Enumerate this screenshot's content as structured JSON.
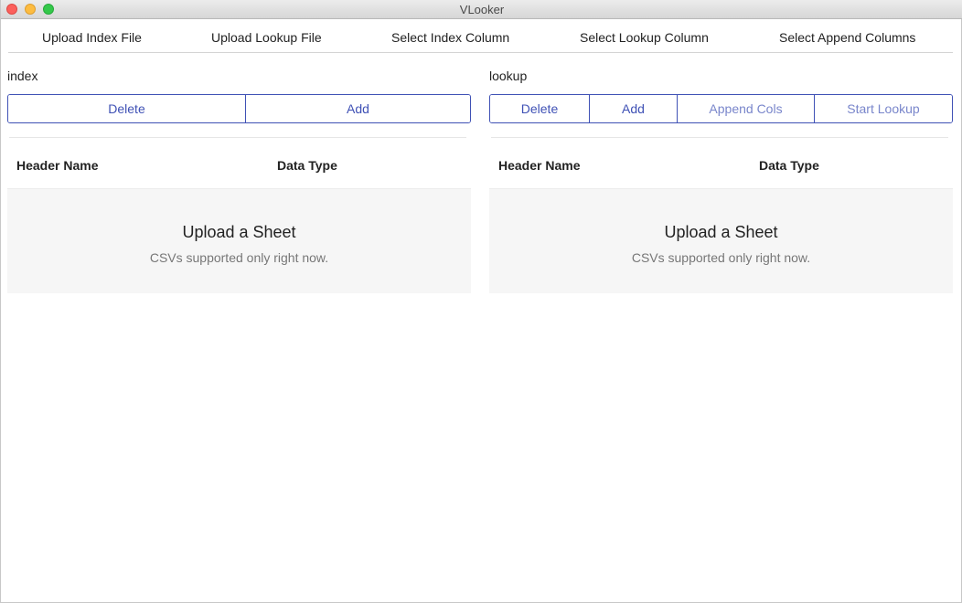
{
  "window": {
    "title": "VLooker"
  },
  "steps": [
    "Upload Index File",
    "Upload Lookup File",
    "Select Index Column",
    "Select Lookup Column",
    "Select Append Columns"
  ],
  "index_panel": {
    "label": "index",
    "buttons": {
      "delete": "Delete",
      "add": "Add"
    },
    "columns": {
      "header_name": "Header Name",
      "data_type": "Data Type"
    },
    "empty": {
      "title": "Upload a Sheet",
      "subtitle": "CSVs supported only right now."
    }
  },
  "lookup_panel": {
    "label": "lookup",
    "buttons": {
      "delete": "Delete",
      "add": "Add",
      "append_cols": "Append Cols",
      "start_lookup": "Start Lookup"
    },
    "columns": {
      "header_name": "Header Name",
      "data_type": "Data Type"
    },
    "empty": {
      "title": "Upload a Sheet",
      "subtitle": "CSVs supported only right now."
    }
  },
  "colors": {
    "accent": "#3f51b5",
    "accent_muted": "#7986cb",
    "empty_bg": "#f6f6f6"
  }
}
